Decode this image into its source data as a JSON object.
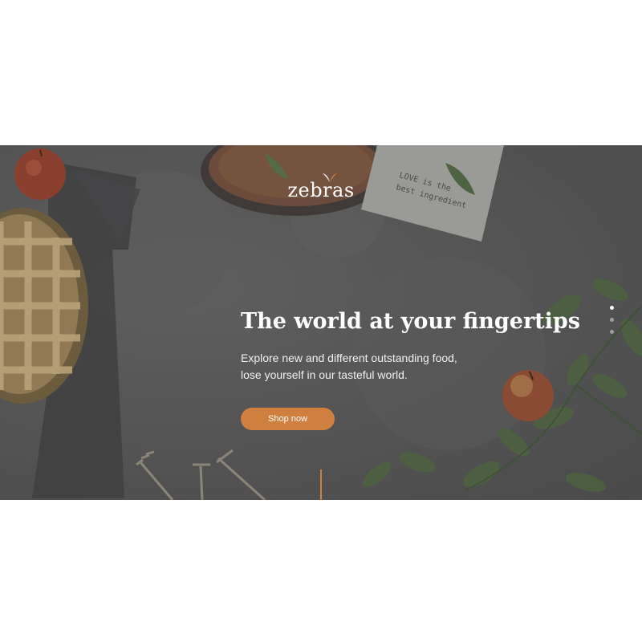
{
  "brand": {
    "name": "zebras",
    "accent_color": "#cf7f3e"
  },
  "hero": {
    "napkin_text_line1": "LOVE is the",
    "napkin_text_line2": "best ingredient",
    "headline": "The world at your fingertips",
    "subtext_line1": "Explore new and different outstanding food,",
    "subtext_line2": "lose yourself in our tasteful world.",
    "cta_label": "Shop now",
    "slider": {
      "total": 3,
      "active_index": 0
    }
  }
}
